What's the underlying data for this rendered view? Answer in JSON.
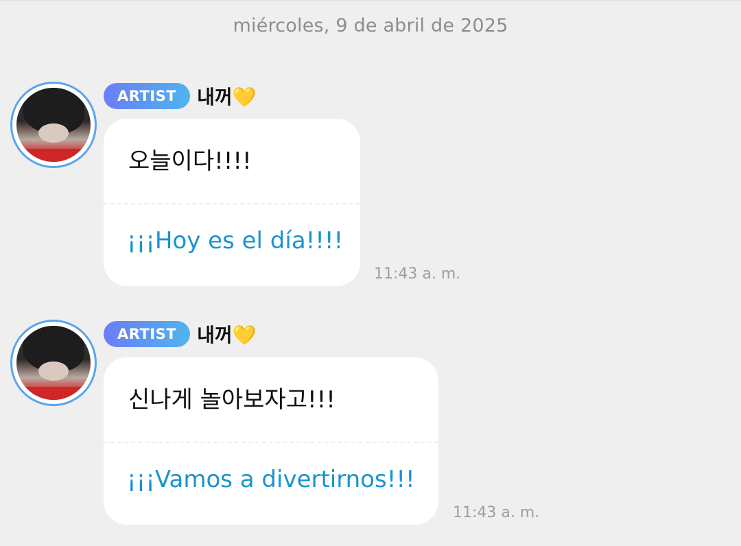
{
  "date_separator": "miércoles, 9 de abril de 2025",
  "messages": [
    {
      "badge": "ARTIST",
      "author": "내꺼💛",
      "original": "오늘이다!!!!",
      "translation": "¡¡¡Hoy es el día!!!!",
      "time": "11:43 a. m."
    },
    {
      "badge": "ARTIST",
      "author": "내꺼💛",
      "original": "신나게 놀아보자고!!!",
      "translation": "¡¡¡Vamos a divertirnos!!!",
      "time": "11:43 a. m."
    }
  ],
  "colors": {
    "background": "#efefef",
    "badge_gradient_start": "#6b7df5",
    "badge_gradient_end": "#4fb4ee",
    "avatar_ring": "#5aa5ee",
    "translation_text": "#1a93d1",
    "timestamp_text": "#9e9e9e"
  }
}
